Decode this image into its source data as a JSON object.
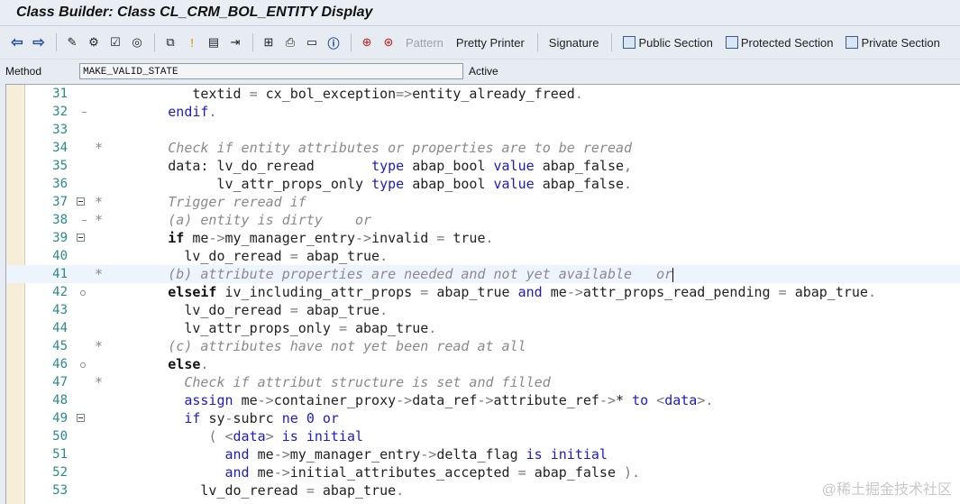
{
  "window": {
    "title": "Class Builder: Class CL_CRM_BOL_ENTITY Display"
  },
  "toolbar": {
    "back_icon": "back-arrow-icon",
    "forward_icon": "forward-arrow-icon",
    "pattern_label": "Pattern",
    "pretty_printer_label": "Pretty Printer",
    "signature_label": "Signature",
    "public_section_label": "Public Section",
    "protected_section_label": "Protected Section",
    "private_section_label": "Private Section"
  },
  "method_bar": {
    "label": "Method",
    "value": "MAKE_VALID_STATE",
    "status": "Active"
  },
  "editor": {
    "line_numbers": [
      "31",
      "32",
      "33",
      "34",
      "35",
      "36",
      "37",
      "38",
      "39",
      "40",
      "41",
      "42",
      "43",
      "44",
      "45",
      "46",
      "47",
      "48",
      "49",
      "50",
      "51",
      "52",
      "53"
    ],
    "lines": [
      "            textid = cx_bol_exception=>entity_already_freed.",
      "         endif.",
      "",
      "*        Check if entity attributes or properties are to be reread",
      "         data: lv_do_reread       type abap_bool value abap_false,",
      "               lv_attr_props_only type abap_bool value abap_false.",
      "*        Trigger reread if",
      "*        (a) entity is dirty    or",
      "         if me->my_manager_entry->invalid = true.",
      "           lv_do_reread = abap_true.",
      "*        (b) attribute properties are needed and not yet available   or",
      "         elseif iv_including_attr_props = abap_true and me->attr_props_read_pending = abap_true.",
      "           lv_do_reread = abap_true.",
      "           lv_attr_props_only = abap_true.",
      "*        (c) attributes have not yet been read at all",
      "         else.",
      "*          Check if attribut structure is set and filled",
      "           assign me->container_proxy->data_ref->attribute_ref->* to <data>.",
      "           if sy-subrc ne 0 or",
      "              ( <data> is initial",
      "                and me->my_manager_entry->delta_flag is initial",
      "                and me->initial_attributes_accepted = abap_false ).",
      "             lv_do_reread = abap_true."
    ]
  },
  "watermark": "@稀土掘金技术社区"
}
